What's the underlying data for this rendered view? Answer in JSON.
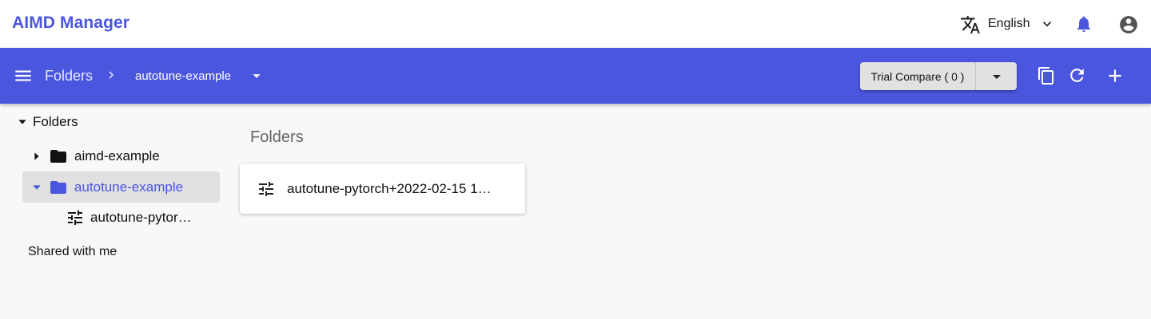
{
  "header": {
    "app_title": "AIMD Manager",
    "language_label": "English",
    "icons": [
      "translate-icon",
      "chevron-down-icon",
      "bell-icon",
      "account-circle-icon"
    ],
    "accent_color": "#4b56de"
  },
  "toolbar": {
    "breadcrumb_root": "Folders",
    "breadcrumb_current": "autotune-example",
    "compare_label": "Trial Compare ( 0 )",
    "icons": [
      "menu-icon",
      "chevron-right-icon",
      "arrow-drop-down-icon",
      "copy-icon",
      "refresh-icon",
      "add-icon"
    ],
    "background_color": "#4b56de"
  },
  "sidebar": {
    "root_label": "Folders",
    "items": [
      {
        "label": "aimd-example",
        "icon": "folder-icon",
        "expanded": false,
        "selected": false
      },
      {
        "label": "autotune-example",
        "icon": "folder-icon",
        "expanded": true,
        "selected": true
      },
      {
        "label": "autotune-pytor…",
        "icon": "tune-icon",
        "expanded": false,
        "selected": false
      }
    ],
    "shared_label": "Shared with me"
  },
  "main": {
    "section_title": "Folders",
    "cards": [
      {
        "label": "autotune-pytorch+2022-02-15 1…",
        "icon": "tune-icon"
      }
    ]
  }
}
